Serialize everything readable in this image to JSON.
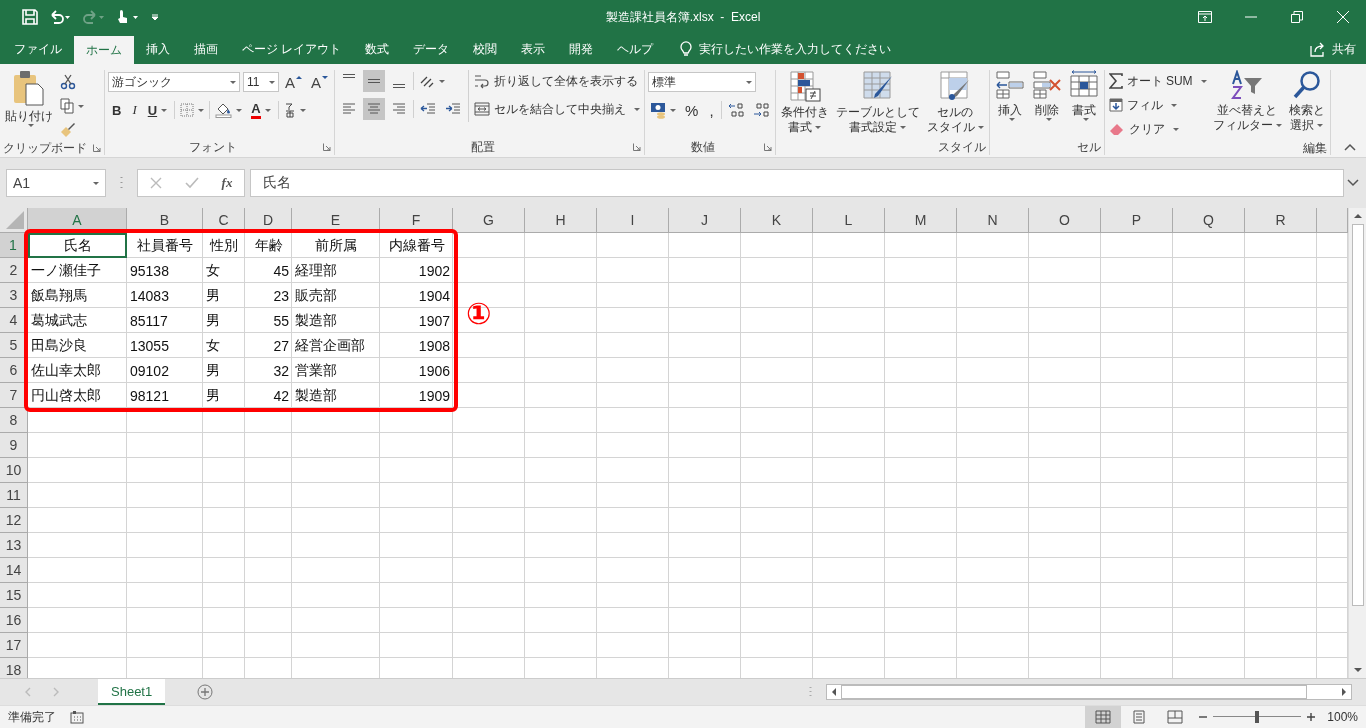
{
  "window": {
    "title": "製造課社員名簿.xlsx  -  Excel"
  },
  "tabs": [
    {
      "label": "ファイル",
      "selected": false
    },
    {
      "label": "ホーム",
      "selected": true
    },
    {
      "label": "挿入",
      "selected": false
    },
    {
      "label": "描画",
      "selected": false
    },
    {
      "label": "ページ レイアウト",
      "selected": false
    },
    {
      "label": "数式",
      "selected": false
    },
    {
      "label": "データ",
      "selected": false
    },
    {
      "label": "校閲",
      "selected": false
    },
    {
      "label": "表示",
      "selected": false
    },
    {
      "label": "開発",
      "selected": false
    },
    {
      "label": "ヘルプ",
      "selected": false
    }
  ],
  "tell_me": {
    "placeholder": "実行したい作業を入力してください"
  },
  "share": "共有",
  "ribbon": {
    "clipboard": {
      "label": "クリップボード",
      "paste": "貼り付け"
    },
    "font": {
      "label": "フォント",
      "name": "游ゴシック",
      "size": "11",
      "grow": "A",
      "shrink": "A",
      "bold": "B",
      "italic": "I",
      "underline": "U",
      "font_color_glyph": "A"
    },
    "alignment": {
      "label": "配置",
      "vertical": [
        {
          "selected": false
        },
        {
          "selected": true
        },
        {
          "selected": false
        }
      ],
      "horizontal": [
        {
          "selected": false
        },
        {
          "selected": true
        },
        {
          "selected": false
        }
      ],
      "wrap": "折り返して全体を表示する",
      "merge": "セルを結合して中央揃え"
    },
    "number": {
      "label": "数値",
      "format": "標準",
      "percent": "%",
      "comma": ","
    },
    "styles": {
      "label": "スタイル",
      "buttons": [
        [
          "条件付き",
          "書式"
        ],
        [
          "テーブルとして",
          "書式設定"
        ],
        [
          "セルの",
          "スタイル"
        ]
      ]
    },
    "cells": {
      "label": "セル",
      "buttons": [
        "挿入",
        "削除",
        "書式"
      ]
    },
    "editing": {
      "label": "編集",
      "autosum": "オート SUM",
      "fill": "フィル",
      "clear": "クリア",
      "sort": [
        "並べ替えと",
        "フィルター"
      ],
      "find": [
        "検索と",
        "選択"
      ]
    }
  },
  "name_box": "A1",
  "formula": {
    "fx": "fx",
    "value": "氏名"
  },
  "columns": [
    {
      "letter": "A",
      "selected": true,
      "right_aligned": false
    },
    {
      "letter": "B",
      "selected": false,
      "right_aligned": false
    },
    {
      "letter": "C",
      "selected": false,
      "right_aligned": false
    },
    {
      "letter": "D",
      "selected": false,
      "right_aligned": true
    },
    {
      "letter": "E",
      "selected": false,
      "right_aligned": false
    },
    {
      "letter": "F",
      "selected": false,
      "right_aligned": true
    },
    {
      "letter": "G",
      "selected": false
    },
    {
      "letter": "H",
      "selected": false
    },
    {
      "letter": "I",
      "selected": false
    },
    {
      "letter": "J",
      "selected": false
    },
    {
      "letter": "K",
      "selected": false
    },
    {
      "letter": "L",
      "selected": false
    },
    {
      "letter": "M",
      "selected": false
    },
    {
      "letter": "N",
      "selected": false
    },
    {
      "letter": "O",
      "selected": false
    },
    {
      "letter": "P",
      "selected": false
    },
    {
      "letter": "Q",
      "selected": false
    },
    {
      "letter": "R",
      "selected": false
    }
  ],
  "rows": [
    {
      "number": "1",
      "selected": true,
      "kind": "header",
      "cells": [
        "氏名",
        "社員番号",
        "性別",
        "年齢",
        "前所属",
        "内線番号"
      ]
    },
    {
      "number": "2",
      "selected": false,
      "kind": "data",
      "cells": [
        "一ノ瀬佳子",
        "95138",
        "女",
        "45",
        "経理部",
        "1902"
      ]
    },
    {
      "number": "3",
      "selected": false,
      "kind": "data",
      "cells": [
        "飯島翔馬",
        "14083",
        "男",
        "23",
        "販売部",
        "1904"
      ]
    },
    {
      "number": "4",
      "selected": false,
      "kind": "data",
      "cells": [
        "葛城武志",
        "85117",
        "男",
        "55",
        "製造部",
        "1907"
      ]
    },
    {
      "number": "5",
      "selected": false,
      "kind": "data",
      "cells": [
        "田島沙良",
        "13055",
        "女",
        "27",
        "経営企画部",
        "1908"
      ]
    },
    {
      "number": "6",
      "selected": false,
      "kind": "data",
      "cells": [
        "佐山幸太郎",
        "09102",
        "男",
        "32",
        "営業部",
        "1906"
      ]
    },
    {
      "number": "7",
      "selected": false,
      "kind": "data",
      "cells": [
        "円山啓太郎",
        "98121",
        "男",
        "42",
        "製造部",
        "1909"
      ]
    },
    {
      "number": "8",
      "selected": false
    },
    {
      "number": "9",
      "selected": false
    },
    {
      "number": "10",
      "selected": false
    },
    {
      "number": "11",
      "selected": false
    },
    {
      "number": "12",
      "selected": false
    },
    {
      "number": "13",
      "selected": false
    },
    {
      "number": "14",
      "selected": false
    },
    {
      "number": "15",
      "selected": false
    },
    {
      "number": "16",
      "selected": false
    },
    {
      "number": "17",
      "selected": false
    },
    {
      "number": "18",
      "selected": false
    }
  ],
  "annotation": {
    "label": "①"
  },
  "sheets": [
    {
      "label": "Sheet1",
      "selected": true
    }
  ],
  "status": {
    "text": "準備完了",
    "views": [
      {
        "selected": true
      },
      {
        "selected": false
      },
      {
        "selected": false
      }
    ],
    "zoom_slider": {
      "level": 0.5
    },
    "zoom": "100%"
  }
}
